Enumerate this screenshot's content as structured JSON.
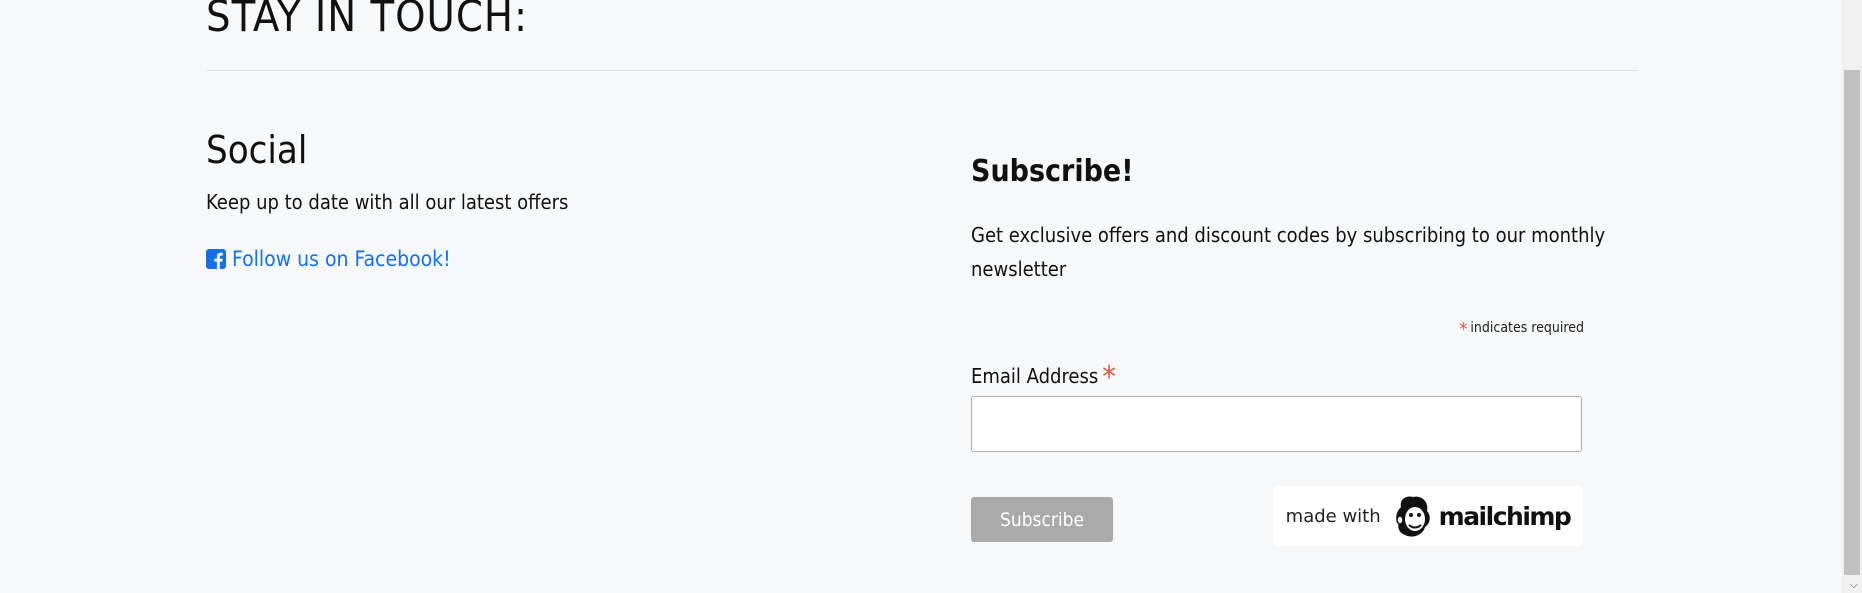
{
  "page": {
    "heading": "STAY IN TOUCH:"
  },
  "social": {
    "heading": "Social",
    "text": "Keep up to date with all our latest offers",
    "facebook_link": "Follow us on Facebook!",
    "facebook_icon": "facebook-icon"
  },
  "subscribe": {
    "heading": "Subscribe!",
    "text": "Get exclusive offers and discount codes by subscribing to our monthly newsletter",
    "required_marker": "*",
    "required_note": "indicates required",
    "email_label": "Email Address",
    "email_value": "",
    "button_label": "Subscribe"
  },
  "badge": {
    "made_with": "made with",
    "brand": "mailchimp",
    "icon": "mailchimp-freddie-icon"
  },
  "colors": {
    "background": "#f7f8fa",
    "link": "#1771e6",
    "required": "#e0513b",
    "button": "#aaaaaa"
  }
}
